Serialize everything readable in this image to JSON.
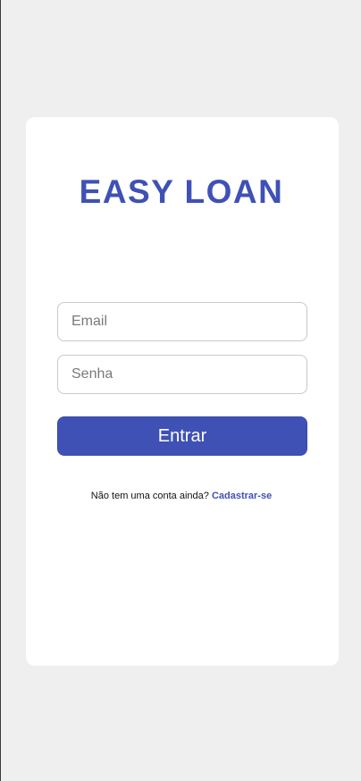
{
  "app": {
    "title": "EASY LOAN"
  },
  "form": {
    "email_placeholder": "Email",
    "password_placeholder": "Senha",
    "submit_label": "Entrar"
  },
  "signup": {
    "prompt": "Não tem uma conta ainda?",
    "link_label": "Cadastrar-se"
  },
  "colors": {
    "accent": "#3f51b5",
    "background": "#efefef",
    "card": "#ffffff"
  }
}
